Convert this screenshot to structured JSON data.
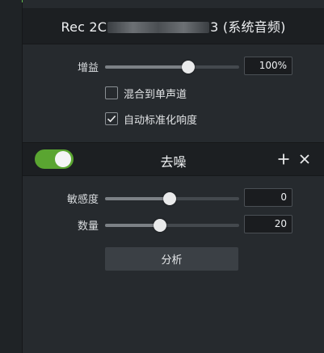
{
  "header": {
    "title_prefix": "Rec 2C",
    "title_suffix": "3 (系统音频)"
  },
  "gain": {
    "label": "增益",
    "value": "100%",
    "level": 0.62
  },
  "mix_mono": {
    "label": "混合到单声道",
    "checked": false
  },
  "auto_normalize": {
    "label": "自动标准化响度",
    "checked": true
  },
  "denoise": {
    "title": "去噪",
    "enabled": true,
    "sensitivity": {
      "label": "敏感度",
      "value": "0",
      "level": 0.48
    },
    "amount": {
      "label": "数量",
      "value": "20",
      "level": 0.41
    },
    "analyze_label": "分析"
  },
  "colors": {
    "accent": "#5aa531",
    "panel": "#262a2e",
    "header": "#1c1f22"
  },
  "icons": {
    "add": "plus-icon",
    "close": "close-icon",
    "check": "checkmark-icon"
  }
}
